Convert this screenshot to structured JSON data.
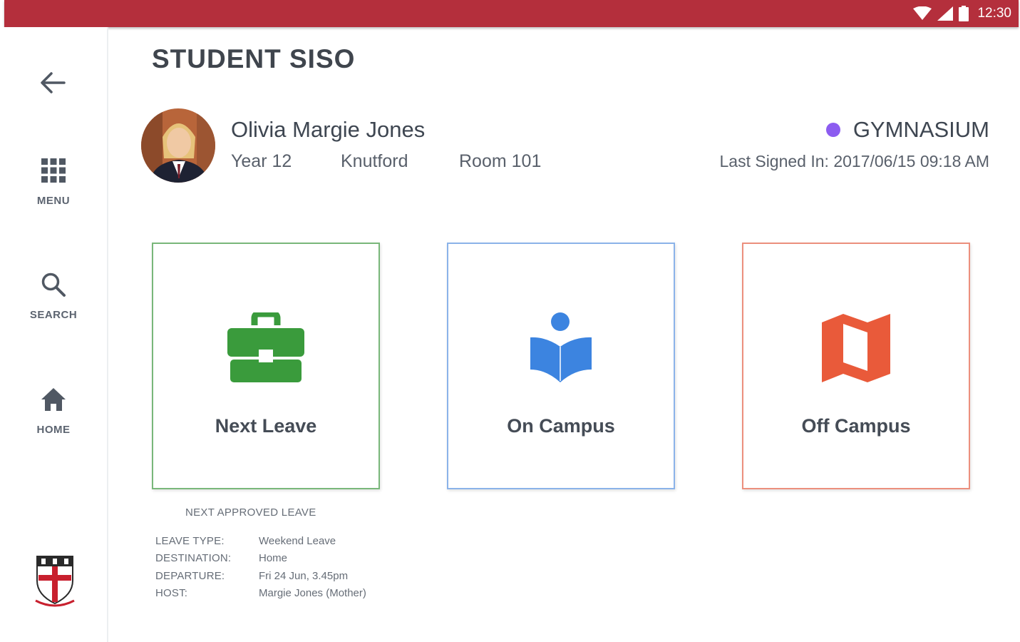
{
  "status_bar": {
    "time": "12:30",
    "icons": [
      "wifi-icon",
      "signal-icon",
      "battery-icon"
    ]
  },
  "sidebar": {
    "items": [
      {
        "label": "MENU",
        "icon": "grid-icon"
      },
      {
        "label": "SEARCH",
        "icon": "search-icon"
      },
      {
        "label": "HOME",
        "icon": "home-icon"
      }
    ]
  },
  "page": {
    "title": "STUDENT SISO"
  },
  "student": {
    "name": "Olivia Margie Jones",
    "year": "Year 12",
    "house": "Knutford",
    "room": "Room 101",
    "location": "GYMNASIUM",
    "last_signed": "Last Signed In: 2017/06/15 09:18 AM"
  },
  "cards": [
    {
      "label": "Next Leave",
      "icon": "briefcase-icon",
      "color": "#3a9b3c"
    },
    {
      "label": "On Campus",
      "icon": "reading-icon",
      "color": "#3c84e0"
    },
    {
      "label": "Off Campus",
      "icon": "map-icon",
      "color": "#e95a3a"
    }
  ],
  "leave": {
    "heading": "NEXT APPROVED LEAVE",
    "rows": [
      {
        "key": "LEAVE TYPE:",
        "value": "Weekend Leave"
      },
      {
        "key": "DESTINATION:",
        "value": "Home"
      },
      {
        "key": "DEPARTURE:",
        "value": "Fri 24 Jun, 3.45pm"
      },
      {
        "key": "HOST:",
        "value": "Margie Jones (Mother)"
      }
    ]
  },
  "colors": {
    "status_bar": "#b42f3c",
    "location_dot": "#8c5cf0"
  }
}
